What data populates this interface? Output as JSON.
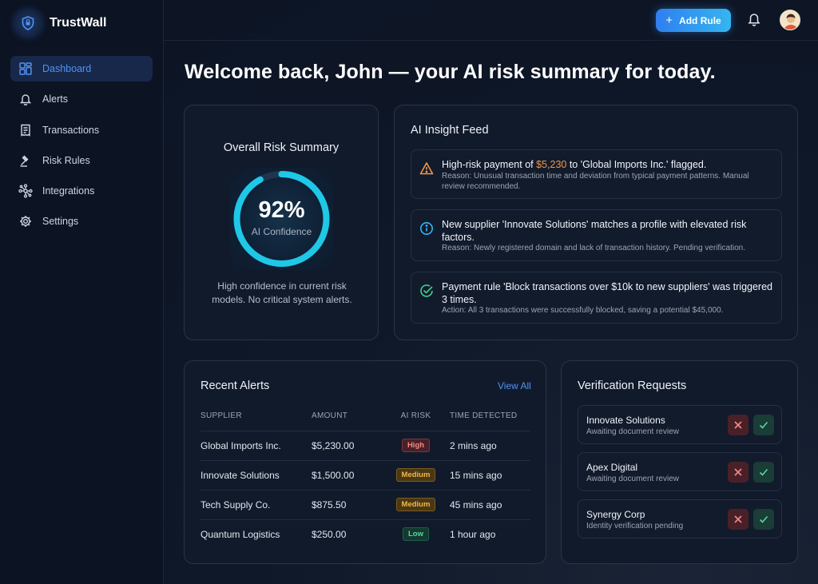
{
  "brand": {
    "name": "TrustWall"
  },
  "sidebar": {
    "items": [
      {
        "label": "Dashboard",
        "icon": "dashboard-icon",
        "active": true
      },
      {
        "label": "Alerts",
        "icon": "bell-icon"
      },
      {
        "label": "Transactions",
        "icon": "receipt-icon"
      },
      {
        "label": "Risk Rules",
        "icon": "gavel-icon"
      },
      {
        "label": "Integrations",
        "icon": "network-icon"
      },
      {
        "label": "Settings",
        "icon": "gear-icon"
      }
    ]
  },
  "header": {
    "add_rule_label": "Add Rule"
  },
  "page": {
    "title": "Welcome back, John — your AI risk summary for today."
  },
  "risk_summary": {
    "title": "Overall Risk Summary",
    "value": "92%",
    "progress": 0.92,
    "label": "AI Confidence",
    "description": "High confidence in current risk models. No critical system alerts."
  },
  "insight_feed": {
    "title": "AI Insight Feed",
    "items": [
      {
        "type": "warning",
        "title_pre": "High-risk payment of ",
        "amount": "$5,230",
        "title_post": " to 'Global Imports Inc.' flagged.",
        "sub": "Reason: Unusual transaction time and deviation from typical payment patterns. Manual review recommended."
      },
      {
        "type": "info",
        "title": "New supplier 'Innovate Solutions' matches a profile with elevated risk factors.",
        "sub": "Reason: Newly registered domain and lack of transaction history. Pending verification."
      },
      {
        "type": "success",
        "title": "Payment rule 'Block transactions over $10k to new suppliers' was triggered 3 times.",
        "sub": "Action: All 3 transactions were successfully blocked, saving a potential $45,000."
      }
    ]
  },
  "recent_alerts": {
    "title": "Recent Alerts",
    "view_all": "View All",
    "columns": [
      "SUPPLIER",
      "AMOUNT",
      "AI RISK",
      "TIME DETECTED"
    ],
    "rows": [
      {
        "supplier": "Global Imports Inc.",
        "amount": "$5,230.00",
        "risk": "High",
        "time": "2 mins ago"
      },
      {
        "supplier": "Innovate Solutions",
        "amount": "$1,500.00",
        "risk": "Medium",
        "time": "15 mins ago"
      },
      {
        "supplier": "Tech Supply Co.",
        "amount": "$875.50",
        "risk": "Medium",
        "time": "45 mins ago"
      },
      {
        "supplier": "Quantum Logistics",
        "amount": "$250.00",
        "risk": "Low",
        "time": "1 hour ago"
      }
    ]
  },
  "verification": {
    "title": "Verification Requests",
    "items": [
      {
        "name": "Innovate Solutions",
        "status": "Awaiting document review"
      },
      {
        "name": "Apex Digital",
        "status": "Awaiting document review"
      },
      {
        "name": "Synergy Corp",
        "status": "Identity verification pending"
      }
    ]
  },
  "colors": {
    "accent": "#4f93f5",
    "gauge": "#1ec8e6",
    "warning": "#f0974a",
    "info": "#35b5ef",
    "success": "#3ecf8e"
  }
}
